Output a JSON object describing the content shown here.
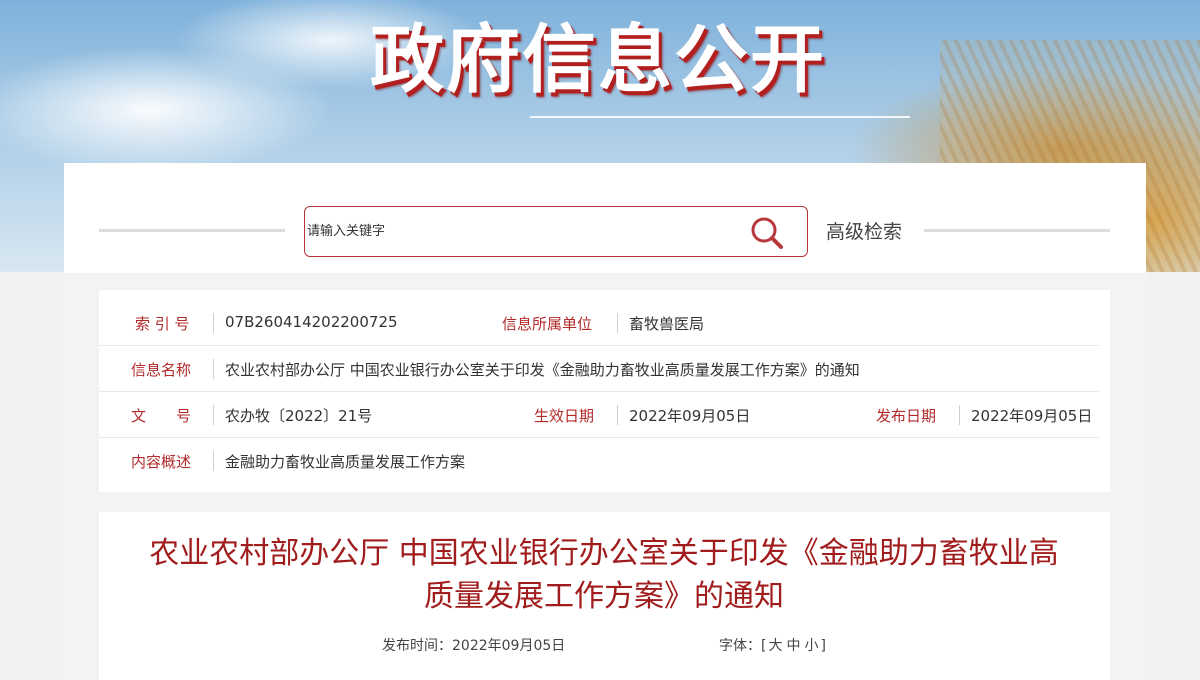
{
  "banner": {
    "title": "政府信息公开"
  },
  "search": {
    "placeholder": "请输入关键字",
    "advanced_label": "高级检索"
  },
  "info": {
    "index_label": "索 引 号",
    "index_value": "07B260414202200725",
    "unit_label": "信息所属单位",
    "unit_value": "畜牧兽医局",
    "name_label": "信息名称",
    "name_value": "农业农村部办公厅 中国农业银行办公室关于印发《金融助力畜牧业高质量发展工作方案》的通知",
    "doc_label": "文　　号",
    "doc_value": "农办牧〔2022〕21号",
    "effective_label": "生效日期",
    "effective_value": "2022年09月05日",
    "publish_label": "发布日期",
    "publish_value": "2022年09月05日",
    "summary_label": "内容概述",
    "summary_value": "金融助力畜牧业高质量发展工作方案"
  },
  "article": {
    "title": "农业农村部办公厅 中国农业银行办公室关于印发《金融助力畜牧业高质量发展工作方案》的通知",
    "publish_time": "发布时间：2022年09月05日",
    "font_label": "字体：",
    "font_open": "[",
    "font_large": "大",
    "font_medium": "中",
    "font_small": "小",
    "font_close": "]"
  },
  "colors": {
    "accent_red": "#b12a2a",
    "title_red": "#a11c1c"
  }
}
